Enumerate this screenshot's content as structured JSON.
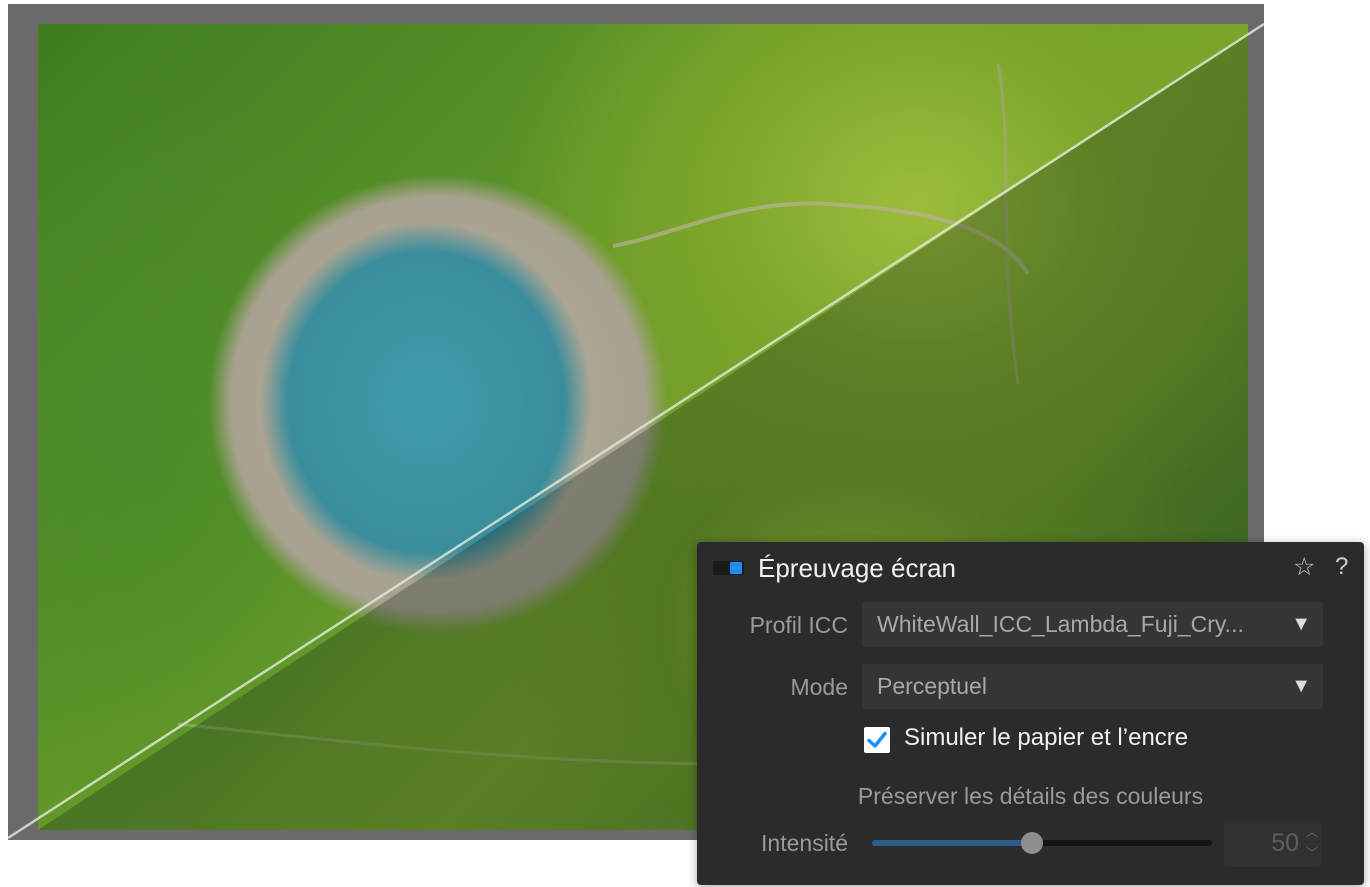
{
  "panel": {
    "title": "Épreuvage écran",
    "accent_color": "#1f8ff5",
    "icons": {
      "favorite": "star-icon",
      "help": "help-icon"
    },
    "star_glyph": "☆",
    "help_glyph": "?",
    "icc_profile": {
      "label": "Profil ICC",
      "value": "WhiteWall_ICC_Lambda_Fuji_Cry..."
    },
    "mode": {
      "label": "Mode",
      "value": "Perceptuel"
    },
    "simulate_paper_ink": {
      "label": "Simuler le papier et l’encre",
      "checked": true
    },
    "preserve_section": "Préserver les détails des couleurs",
    "intensity": {
      "label": "Intensité",
      "value": "50",
      "fraction": 0.47
    }
  }
}
